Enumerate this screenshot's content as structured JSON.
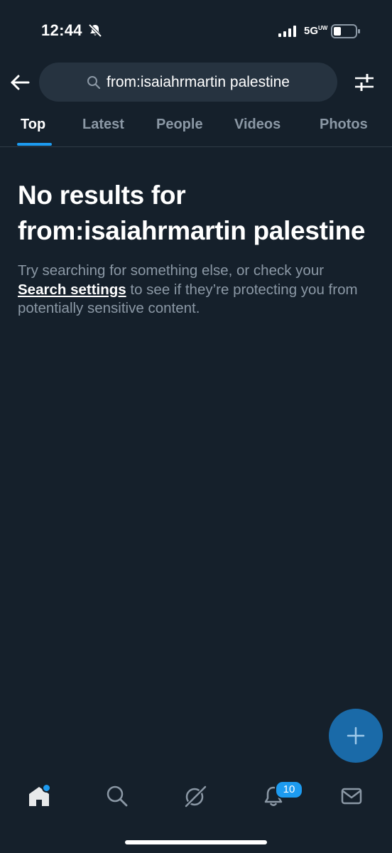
{
  "status_bar": {
    "time": "12:44",
    "network": "5G",
    "network_suffix": "UW"
  },
  "search": {
    "query": "from:isaiahrmartin palestine"
  },
  "tabs": [
    {
      "label": "Top",
      "active": true
    },
    {
      "label": "Latest",
      "active": false
    },
    {
      "label": "People",
      "active": false
    },
    {
      "label": "Videos",
      "active": false
    },
    {
      "label": "Photos",
      "active": false
    }
  ],
  "empty_state": {
    "title": "No results for from:isaiahrmartin palestine",
    "body_prefix": "Try searching for something else, or check your",
    "link_text": "Search settings",
    "body_suffix": "to see if they’re protecting you from potentially sensitive content."
  },
  "bottom_nav": {
    "items": [
      {
        "icon": "home-icon"
      },
      {
        "icon": "search-icon"
      },
      {
        "icon": "grok-icon"
      },
      {
        "icon": "bell-icon"
      },
      {
        "icon": "mail-icon"
      }
    ],
    "notifications_count": "10"
  },
  "icons": {
    "back": "arrow-left-icon",
    "search": "magnifier-icon",
    "filter": "sliders-icon",
    "compose": "plus-icon",
    "silent": "bell-slash-icon"
  },
  "colors": {
    "background": "#15202b",
    "accent": "#1d9bf0",
    "secondary_text": "#8b98a5",
    "search_pill": "#263340"
  }
}
